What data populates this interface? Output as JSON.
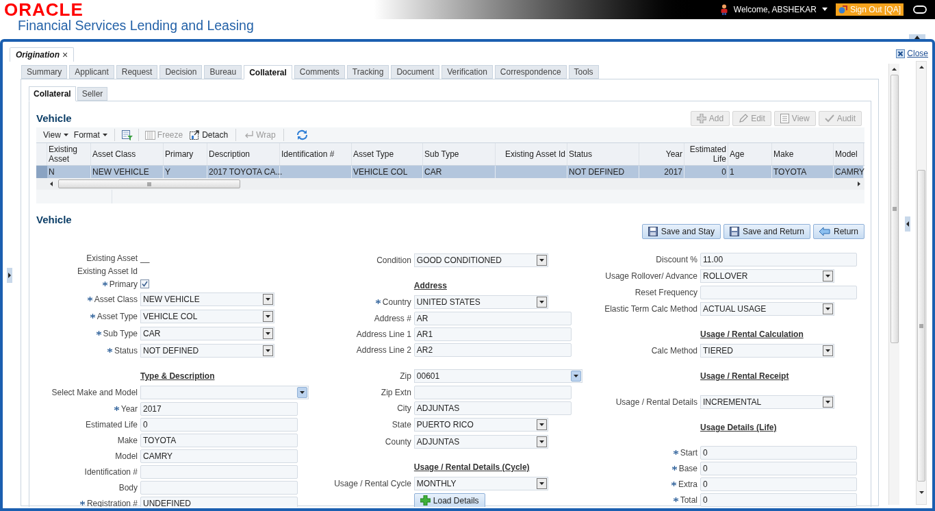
{
  "header": {
    "logo": "ORACLE",
    "product": "Financial Services Lending and Leasing",
    "welcome": "Welcome, ABSHEKAR",
    "sign_out": "Sign Out [QA]"
  },
  "document_tab": {
    "label": "Origination",
    "close": "×"
  },
  "close_link": "Close",
  "tabs": [
    {
      "label": "Summary",
      "selected": false
    },
    {
      "label": "Applicant",
      "selected": false
    },
    {
      "label": "Request",
      "selected": false
    },
    {
      "label": "Decision",
      "selected": false
    },
    {
      "label": "Bureau",
      "selected": false
    },
    {
      "label": "Collateral",
      "selected": true
    },
    {
      "label": "Comments",
      "selected": false
    },
    {
      "label": "Tracking",
      "selected": false
    },
    {
      "label": "Document",
      "selected": false
    },
    {
      "label": "Verification",
      "selected": false
    },
    {
      "label": "Correspondence",
      "selected": false
    },
    {
      "label": "Tools",
      "selected": false
    }
  ],
  "subtabs": [
    {
      "label": "Collateral",
      "selected": true
    },
    {
      "label": "Seller",
      "selected": false
    }
  ],
  "list_section": {
    "title": "Vehicle",
    "actions": [
      {
        "label": "Add",
        "kind": "add",
        "disabled": true
      },
      {
        "label": "Edit",
        "kind": "edit",
        "disabled": true
      },
      {
        "label": "View",
        "kind": "view",
        "disabled": true
      },
      {
        "label": "Audit",
        "kind": "audit",
        "disabled": true
      }
    ],
    "toolbar": [
      {
        "label": "View",
        "kind": "menu",
        "disabled": false
      },
      {
        "label": "Format",
        "kind": "menu",
        "disabled": false
      },
      {
        "kind": "filter",
        "disabled": false
      },
      {
        "label": "Freeze",
        "kind": "freeze",
        "disabled": true
      },
      {
        "label": "Detach",
        "kind": "detach",
        "disabled": false
      },
      {
        "label": "Wrap",
        "kind": "wrap",
        "disabled": true
      },
      {
        "kind": "refresh",
        "disabled": false
      }
    ],
    "table": {
      "columns": [
        "Existing Asset",
        "Asset Class",
        "Primary",
        "Description",
        "Identification #",
        "Asset Type",
        "Sub Type",
        "Existing Asset Id",
        "Status",
        "Year",
        "Estimated Life",
        "Age",
        "Make",
        "Model"
      ],
      "rows": [
        {
          "selected": true,
          "cells": [
            "N",
            "NEW VEHICLE",
            "Y",
            "2017 TOYOTA CA...",
            "",
            "VEHICLE COL",
            "CAR",
            "",
            "NOT DEFINED",
            "2017",
            "0",
            "1",
            "TOYOTA",
            "CAMRY"
          ]
        }
      ]
    }
  },
  "detail_section": {
    "title": "Vehicle",
    "actions": [
      {
        "label": "Save and Stay",
        "kind": "save"
      },
      {
        "label": "Save and Return",
        "kind": "save"
      },
      {
        "label": "Return",
        "kind": "return"
      }
    ],
    "columns": [
      [
        {
          "rows": [
            {
              "kind": "text",
              "label": "Existing Asset",
              "value": "__"
            },
            {
              "kind": "text",
              "label": "Existing Asset Id"
            },
            {
              "kind": "checkbox",
              "label": "Primary",
              "checked": true,
              "required": true
            },
            {
              "kind": "select",
              "label": "Asset Class",
              "value": "NEW VEHICLE",
              "required": true
            },
            {
              "kind": "select",
              "label": "Asset Type",
              "value": "VEHICLE COL",
              "required": true
            },
            {
              "kind": "select",
              "label": "Sub Type",
              "value": "CAR",
              "required": true
            },
            {
              "kind": "select",
              "label": "Status",
              "value": "NOT DEFINED",
              "required": true
            }
          ]
        },
        {
          "heading": "Type & Description",
          "rows": [
            {
              "kind": "combo",
              "label": "Select Make and Model",
              "value": ""
            },
            {
              "kind": "input",
              "label": "Year",
              "value": "2017",
              "required": true
            },
            {
              "kind": "input",
              "label": "Estimated Life",
              "value": "0"
            },
            {
              "kind": "input",
              "label": "Make",
              "value": "TOYOTA"
            },
            {
              "kind": "input",
              "label": "Model",
              "value": "CAMRY"
            },
            {
              "kind": "input",
              "label": "Identification #",
              "value": ""
            },
            {
              "kind": "input",
              "label": "Body",
              "value": ""
            },
            {
              "kind": "input",
              "label": "Registration #",
              "value": "UNDEFINED",
              "required": true
            }
          ]
        }
      ],
      [
        {
          "rows": [
            {
              "kind": "select",
              "label": "Condition",
              "value": "GOOD CONDITIONED"
            }
          ]
        },
        {
          "heading": "Address",
          "rows": [
            {
              "kind": "select",
              "label": "Country",
              "value": "UNITED STATES",
              "required": true
            },
            {
              "kind": "input",
              "label": "Address #",
              "value": "AR"
            },
            {
              "kind": "input",
              "label": "Address Line 1",
              "value": "AR1"
            },
            {
              "kind": "input",
              "label": "Address Line 2",
              "value": "AR2"
            }
          ]
        },
        {
          "rows": [
            {
              "kind": "combo",
              "label": "Zip",
              "value": "00601"
            },
            {
              "kind": "input",
              "label": "Zip Extn",
              "value": ""
            },
            {
              "kind": "input",
              "label": "City",
              "value": "ADJUNTAS"
            },
            {
              "kind": "select",
              "label": "State",
              "value": "PUERTO RICO"
            },
            {
              "kind": "select",
              "label": "County",
              "value": "ADJUNTAS"
            }
          ]
        },
        {
          "heading": "Usage / Rental Details (Cycle)",
          "rows": [
            {
              "kind": "select",
              "label": "Usage / Rental Cycle",
              "value": "MONTHLY"
            },
            {
              "kind": "button",
              "value": "Load Details"
            }
          ]
        }
      ],
      [
        {
          "rows": [
            {
              "kind": "input",
              "label": "Discount %",
              "value": "11.00"
            },
            {
              "kind": "select",
              "label": "Usage Rollover/ Advance",
              "value": "ROLLOVER"
            },
            {
              "kind": "input",
              "label": "Reset Frequency",
              "value": ""
            },
            {
              "kind": "select",
              "label": "Elastic Term Calc Method",
              "value": "ACTUAL USAGE"
            }
          ]
        },
        {
          "heading": "Usage / Rental Calculation",
          "rows": [
            {
              "kind": "select",
              "label": "Calc Method",
              "value": "TIERED"
            }
          ]
        },
        {
          "heading": "Usage / Rental Receipt"
        },
        {
          "rows": [
            {
              "kind": "select",
              "label": "Usage / Rental Details",
              "value": "INCREMENTAL"
            }
          ]
        },
        {
          "heading": "Usage Details (Life)"
        },
        {
          "rows": [
            {
              "kind": "input",
              "label": "Start",
              "value": "0",
              "required": true
            },
            {
              "kind": "input",
              "label": "Base",
              "value": "0",
              "required": true
            },
            {
              "kind": "input",
              "label": "Extra",
              "value": "0",
              "required": true
            },
            {
              "kind": "input",
              "label": "Total",
              "value": "0",
              "required": true
            }
          ]
        }
      ]
    ]
  }
}
